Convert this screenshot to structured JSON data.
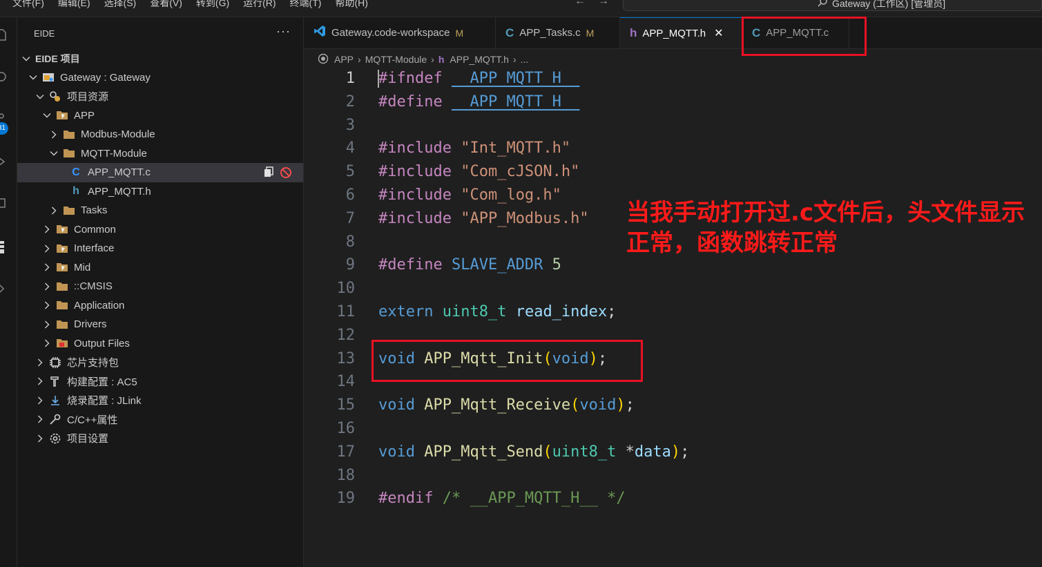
{
  "menu": [
    "文件(F)",
    "编辑(E)",
    "选择(S)",
    "查看(V)",
    "转到(G)",
    "运行(R)",
    "终端(T)",
    "帮助(H)"
  ],
  "command_center": {
    "text": "Gateway (工作区) [管理员]"
  },
  "activity_badge": "31",
  "sidebar": {
    "title": "EIDE",
    "section_title": "EIDE 项目",
    "tree": [
      {
        "label": "Gateway : Gateway",
        "depth": 1,
        "chevron": "down",
        "icon": "project"
      },
      {
        "label": "项目资源",
        "depth": 2,
        "chevron": "down",
        "icon": "resources"
      },
      {
        "label": "APP",
        "depth": 3,
        "chevron": "down",
        "icon": "folder-special"
      },
      {
        "label": "Modbus-Module",
        "depth": 4,
        "chevron": "right",
        "icon": "folder"
      },
      {
        "label": "MQTT-Module",
        "depth": 4,
        "chevron": "down",
        "icon": "folder"
      },
      {
        "label": "APP_MQTT.c",
        "depth": 5,
        "chevron": "none",
        "icon": "c-file",
        "selected": true
      },
      {
        "label": "APP_MQTT.h",
        "depth": 5,
        "chevron": "none",
        "icon": "h-file"
      },
      {
        "label": "Tasks",
        "depth": 4,
        "chevron": "right",
        "icon": "folder"
      },
      {
        "label": "Common",
        "depth": 3,
        "chevron": "right",
        "icon": "folder-special"
      },
      {
        "label": "Interface",
        "depth": 3,
        "chevron": "right",
        "icon": "folder-special"
      },
      {
        "label": "Mid",
        "depth": 3,
        "chevron": "right",
        "icon": "folder-special"
      },
      {
        "label": "::CMSIS",
        "depth": 3,
        "chevron": "right",
        "icon": "folder"
      },
      {
        "label": "Application",
        "depth": 3,
        "chevron": "right",
        "icon": "folder"
      },
      {
        "label": "Drivers",
        "depth": 3,
        "chevron": "right",
        "icon": "folder"
      },
      {
        "label": "Output Files",
        "depth": 3,
        "chevron": "right",
        "icon": "output"
      },
      {
        "label": "芯片支持包",
        "depth": 2,
        "chevron": "right",
        "icon": "chip"
      },
      {
        "label": "构建配置 : AC5",
        "depth": 2,
        "chevron": "right",
        "icon": "build"
      },
      {
        "label": "烧录配置 : JLink",
        "depth": 2,
        "chevron": "right",
        "icon": "flash"
      },
      {
        "label": "C/C++属性",
        "depth": 2,
        "chevron": "right",
        "icon": "wrench"
      },
      {
        "label": "项目设置",
        "depth": 2,
        "chevron": "right",
        "icon": "gear"
      }
    ]
  },
  "tabs": [
    {
      "label": "Gateway.code-workspace",
      "icon": "vscode",
      "modified": "M"
    },
    {
      "label": "APP_Tasks.c",
      "icon": "c",
      "modified": "M"
    },
    {
      "label": "APP_MQTT.h",
      "icon": "h",
      "active": true
    },
    {
      "label": "APP_MQTT.c",
      "icon": "c",
      "preview": true
    }
  ],
  "breadcrumb": [
    "APP",
    "MQTT-Module",
    "APP_MQTT.h",
    "..."
  ],
  "code_lines": [
    "#ifndef __APP_MQTT_H__",
    "#define __APP_MQTT_H__",
    "",
    "#include \"Int_MQTT.h\"",
    "#include \"Com_cJSON.h\"",
    "#include \"Com_log.h\"",
    "#include \"APP_Modbus.h\"",
    "",
    "#define SLAVE_ADDR 5",
    "",
    "extern uint8_t read_index;",
    "",
    "void APP_Mqtt_Init(void);",
    "",
    "void APP_Mqtt_Receive(void);",
    "",
    "void APP_Mqtt_Send(uint8_t *data);",
    "",
    "#endif /* __APP_MQTT_H__ */"
  ],
  "annotation": {
    "text": "当我手动打开过.c文件后，头文件显示正常，函数跳转正常",
    "color": "#ff1a1a"
  },
  "colors": {
    "accent": "#0078d4",
    "annotation_red": "#e81123"
  }
}
